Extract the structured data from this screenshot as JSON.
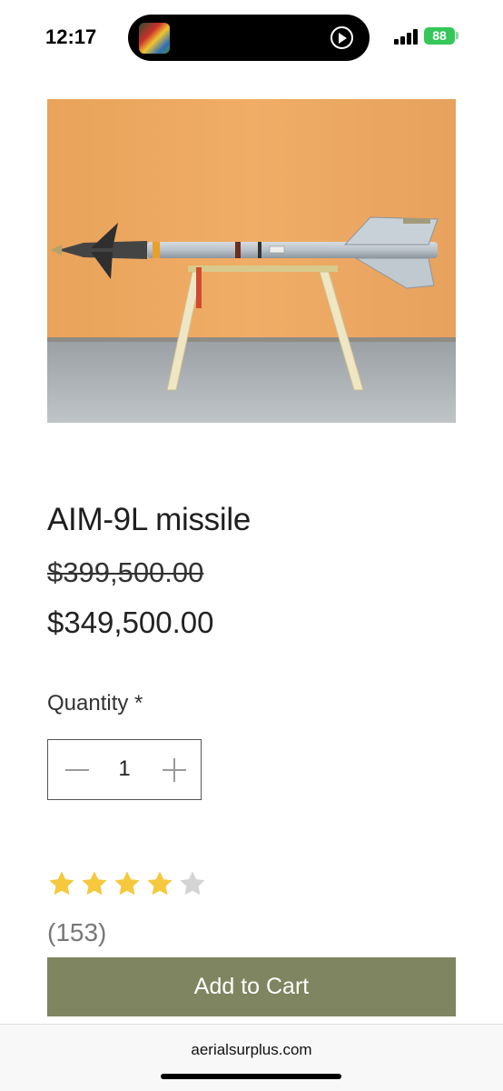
{
  "status_bar": {
    "time": "12:17",
    "battery": "88",
    "icons": [
      "now-playing-artwork-icon",
      "play-circle-icon",
      "signal-icon",
      "battery-icon"
    ]
  },
  "product": {
    "image_name": "missile-on-stand-image",
    "title": "AIM-9L missile",
    "original_price": "$399,500.00",
    "sale_price": "$349,500.00"
  },
  "quantity": {
    "label": "Quantity *",
    "value": "1"
  },
  "rating": {
    "stars": 4,
    "max_stars": 5,
    "count": "(153)",
    "filled_color": "#f6c83e",
    "empty_color": "#d4d4d4"
  },
  "cart": {
    "button_label": "Add to Cart",
    "button_color": "#7f8560"
  },
  "browser": {
    "url": "aerialsurplus.com"
  }
}
